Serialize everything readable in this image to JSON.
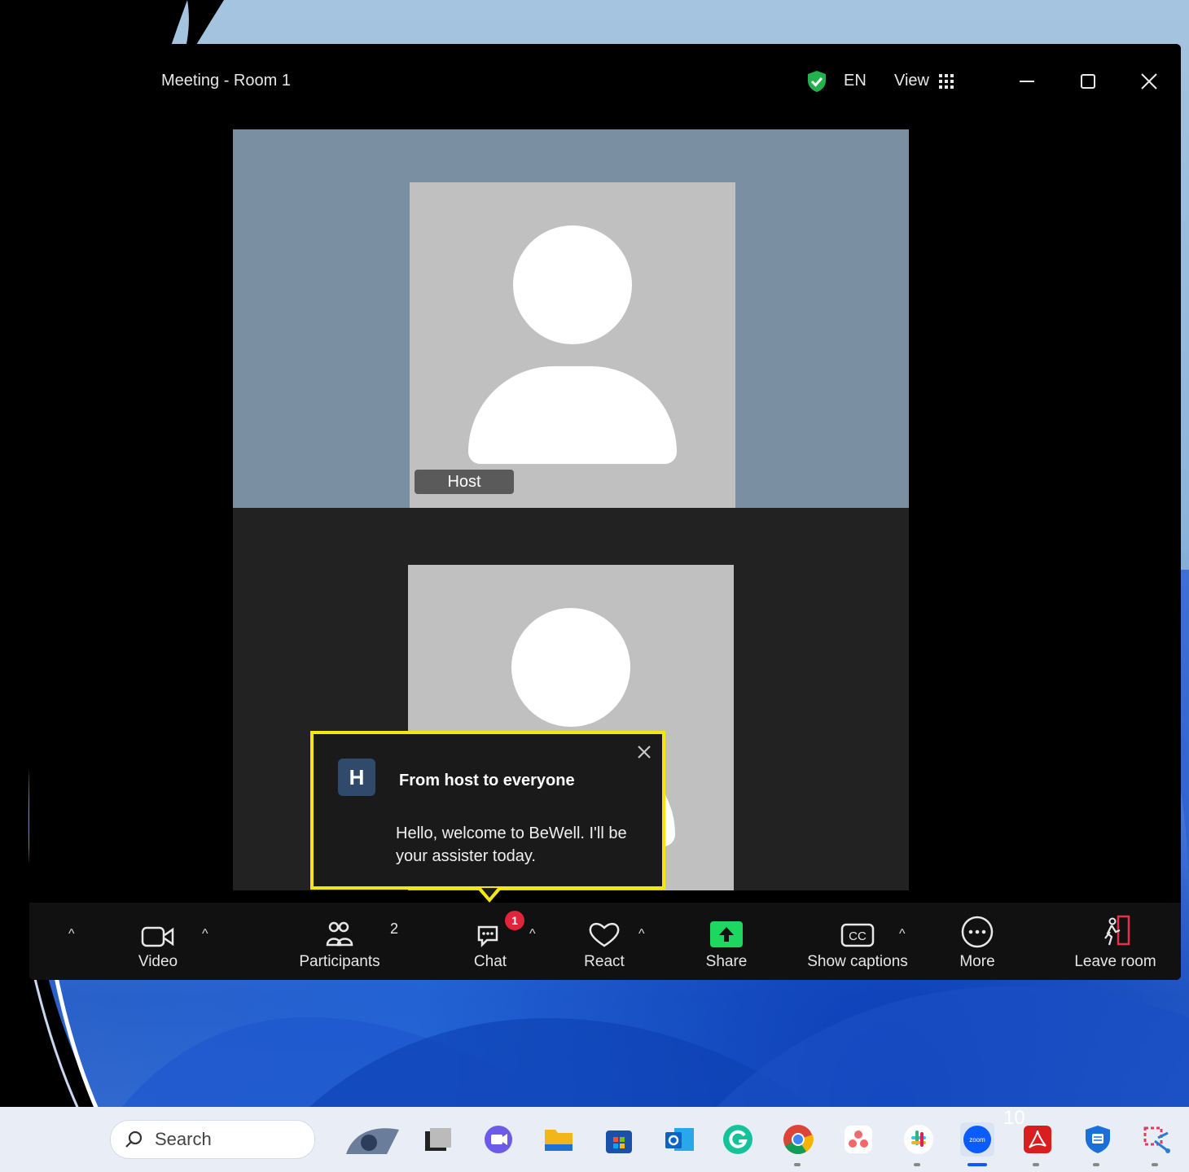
{
  "window": {
    "title": "Meeting - Room 1",
    "language": "EN",
    "view_label": "View"
  },
  "participants_video": [
    {
      "name": "Host"
    }
  ],
  "chat_popup": {
    "avatar_letter": "H",
    "from": "From host to everyone",
    "message": "Hello, welcome to BeWell. I'll be your assister today."
  },
  "toolbar": {
    "video_label": "Video",
    "participants_label": "Participants",
    "participants_count": "2",
    "chat_label": "Chat",
    "chat_badge": "1",
    "react_label": "React",
    "share_label": "Share",
    "captions_label": "Show captions",
    "more_label": "More",
    "leave_label": "Leave room"
  },
  "taskbar": {
    "search_placeholder": "Search",
    "apps": [
      "fan-icon",
      "task-view-icon",
      "teams-icon",
      "file-explorer-icon",
      "store-icon",
      "outlook-icon",
      "grammarly-icon",
      "chrome-icon",
      "asana-icon",
      "slack-icon",
      "zoom-icon",
      "acrobat-icon",
      "defender-icon",
      "snipping-tool-icon"
    ]
  },
  "slide_number": "10",
  "colors": {
    "highlight": "#f5e60f",
    "share_green": "#1ed760",
    "badge_red": "#e0243b",
    "tile_blue_gray": "#7a8fa2"
  }
}
